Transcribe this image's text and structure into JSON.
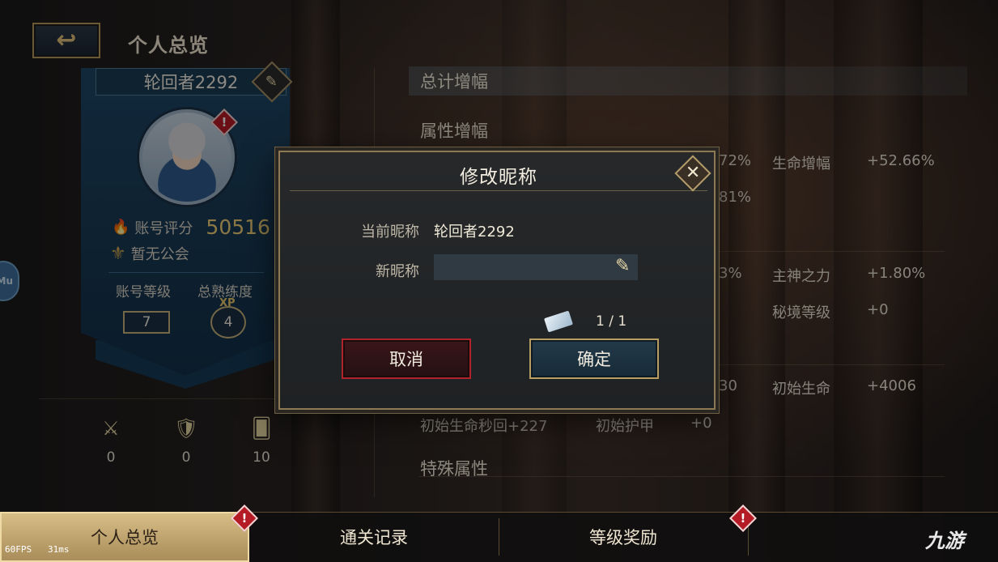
{
  "header": {
    "title": "个人总览",
    "back_icon": "back-arrow-icon"
  },
  "profile": {
    "nickname": "轮回者2292",
    "score_label": "账号评分",
    "score_value": "50516",
    "guild_text": "暂无公会",
    "account_level_label": "账号等级",
    "account_level_value": "7",
    "proficiency_label": "总熟练度",
    "proficiency_xp": "XP",
    "proficiency_value": "4",
    "alert_mark": "!"
  },
  "side_button": {
    "label": "Mu"
  },
  "stats": [
    {
      "icon": "sword-icon",
      "value": "0"
    },
    {
      "icon": "armor-icon",
      "value": "0"
    },
    {
      "icon": "card-star-icon",
      "value": "10"
    }
  ],
  "attributes": {
    "total_header": "总计增幅",
    "attr_section_title": "属性增幅",
    "special_section_title": "特殊属性",
    "visible": [
      {
        "text": "72%"
      },
      {
        "text": "生命增幅"
      },
      {
        "text": "+52.66%"
      },
      {
        "text": "81%"
      },
      {
        "text": "3%"
      },
      {
        "text": "主神之力"
      },
      {
        "text": "+1.80%"
      },
      {
        "text": "秘境等级"
      },
      {
        "text": "+0"
      },
      {
        "text": "30"
      },
      {
        "text": "初始生命"
      },
      {
        "text": "+4006"
      },
      {
        "text": "初始生命秒回+227"
      },
      {
        "text": "初始护甲"
      },
      {
        "text": "+0"
      }
    ]
  },
  "dialog": {
    "title": "修改昵称",
    "close_glyph": "✕",
    "current_label": "当前昵称",
    "current_value": "轮回者2292",
    "new_label": "新昵称",
    "new_value": "",
    "ticket_count": "1 / 1",
    "cancel_label": "取消",
    "confirm_label": "确定"
  },
  "tabs": [
    {
      "label": "个人总览",
      "active": true,
      "alert": true
    },
    {
      "label": "通关记录",
      "active": false,
      "alert": false
    },
    {
      "label": "等级奖励",
      "active": false,
      "alert": true
    }
  ],
  "debug": {
    "fps": "60FPS",
    "ms": "31ms"
  },
  "watermark": "九游",
  "colors": {
    "accent_gold": "#b89d62",
    "card_blue": "#1e4766",
    "cancel_red": "#b0232a",
    "alert_red": "#b51b25",
    "score_gold": "#f1cf75"
  }
}
